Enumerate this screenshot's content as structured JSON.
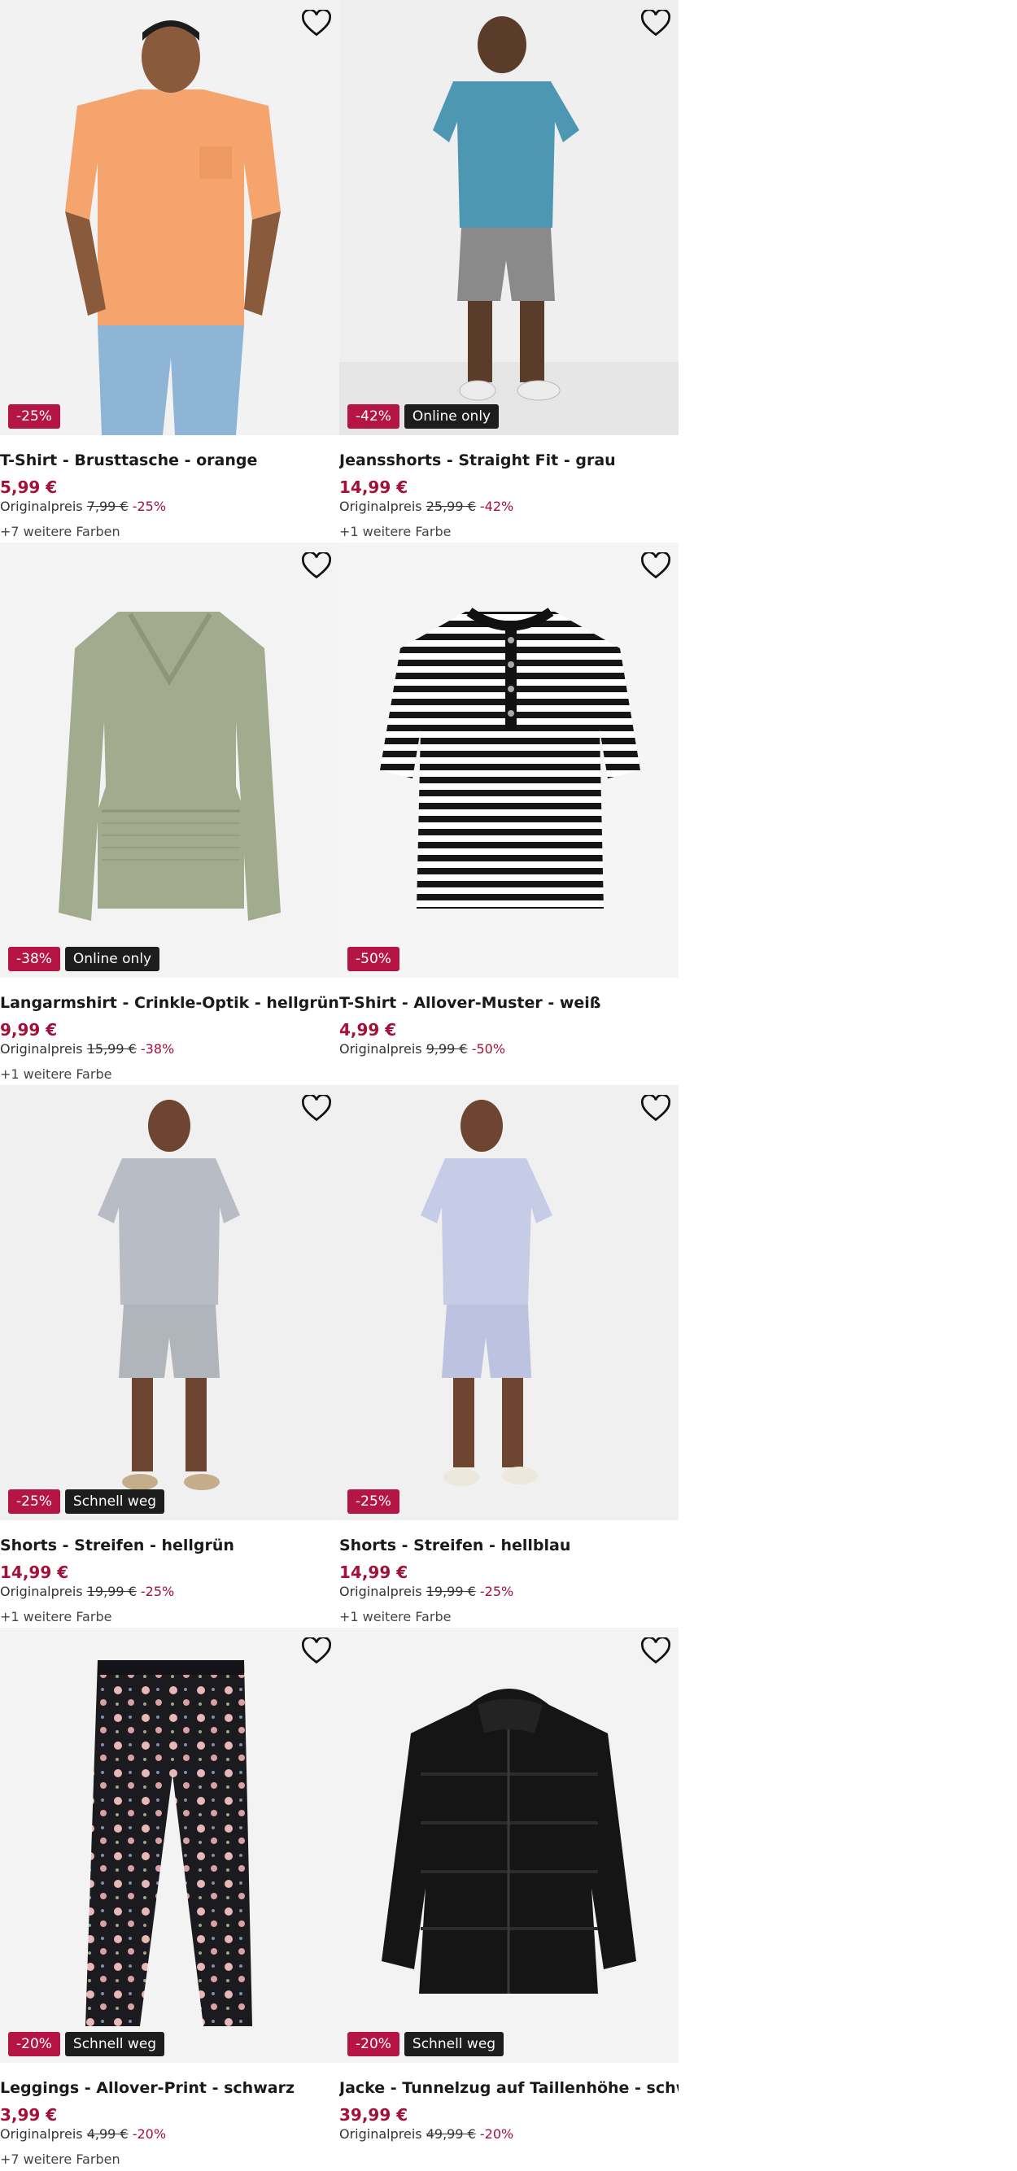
{
  "products": [
    {
      "title": "T-Shirt - Brusttasche - orange",
      "price": "5,99 €",
      "orig_label": "Originalpreis",
      "orig_price": "7,99 €",
      "orig_pct": "-25%",
      "colors": "+7 weitere Farben",
      "badges": [
        "-25%"
      ],
      "image_icon": "man-orange-tshirt-image"
    },
    {
      "title": "Jeansshorts - Straight Fit - grau",
      "price": "14,99 €",
      "orig_label": "Originalpreis",
      "orig_price": "25,99 €",
      "orig_pct": "-42%",
      "colors": "+1 weitere Farbe",
      "badges": [
        "-42%",
        "Online only"
      ],
      "image_icon": "man-grey-shorts-image"
    },
    {
      "title": "Langarmshirt - Crinkle-Optik - hellgrün",
      "price": "9,99 €",
      "orig_label": "Originalpreis",
      "orig_price": "15,99 €",
      "orig_pct": "-38%",
      "colors": "+1 weitere Farbe",
      "badges": [
        "-38%",
        "Online only"
      ],
      "image_icon": "green-longsleeve-image"
    },
    {
      "title": "T-Shirt - Allover-Muster - weiß",
      "price": "4,99 €",
      "orig_label": "Originalpreis",
      "orig_price": "9,99 €",
      "orig_pct": "-50%",
      "colors": "",
      "badges": [
        "-50%"
      ],
      "image_icon": "striped-tshirt-image"
    },
    {
      "title": "Shorts - Streifen - hellgrün",
      "price": "14,99 €",
      "orig_label": "Originalpreis",
      "orig_price": "19,99 €",
      "orig_pct": "-25%",
      "colors": "+1 weitere Farbe",
      "badges": [
        "-25%",
        "Schnell weg"
      ],
      "image_icon": "man-striped-set-image"
    },
    {
      "title": "Shorts - Streifen - hellblau",
      "price": "14,99 €",
      "orig_label": "Originalpreis",
      "orig_price": "19,99 €",
      "orig_pct": "-25%",
      "colors": "+1 weitere Farbe",
      "badges": [
        "-25%"
      ],
      "image_icon": "man-blue-set-image"
    },
    {
      "title": "Leggings - Allover-Print - schwarz",
      "price": "3,99 €",
      "orig_label": "Originalpreis",
      "orig_price": "4,99 €",
      "orig_pct": "-20%",
      "colors": "+7 weitere Farben",
      "badges": [
        "-20%",
        "Schnell weg"
      ],
      "image_icon": "floral-leggings-image"
    },
    {
      "title": "Jacke - Tunnelzug auf Taillenhöhe - schwarz",
      "price": "39,99 €",
      "orig_label": "Originalpreis",
      "orig_price": "49,99 €",
      "orig_pct": "-20%",
      "colors": "",
      "badges": [
        "-20%",
        "Schnell weg"
      ],
      "image_icon": "black-puffer-jacket-image"
    }
  ],
  "colors": {
    "price": "#a4103a",
    "discount_badge": "#b51545",
    "dark_badge": "#1d1d1d",
    "image_bg": "#f3f3f3"
  },
  "icons": {
    "wishlist": "heart-outline-icon"
  }
}
